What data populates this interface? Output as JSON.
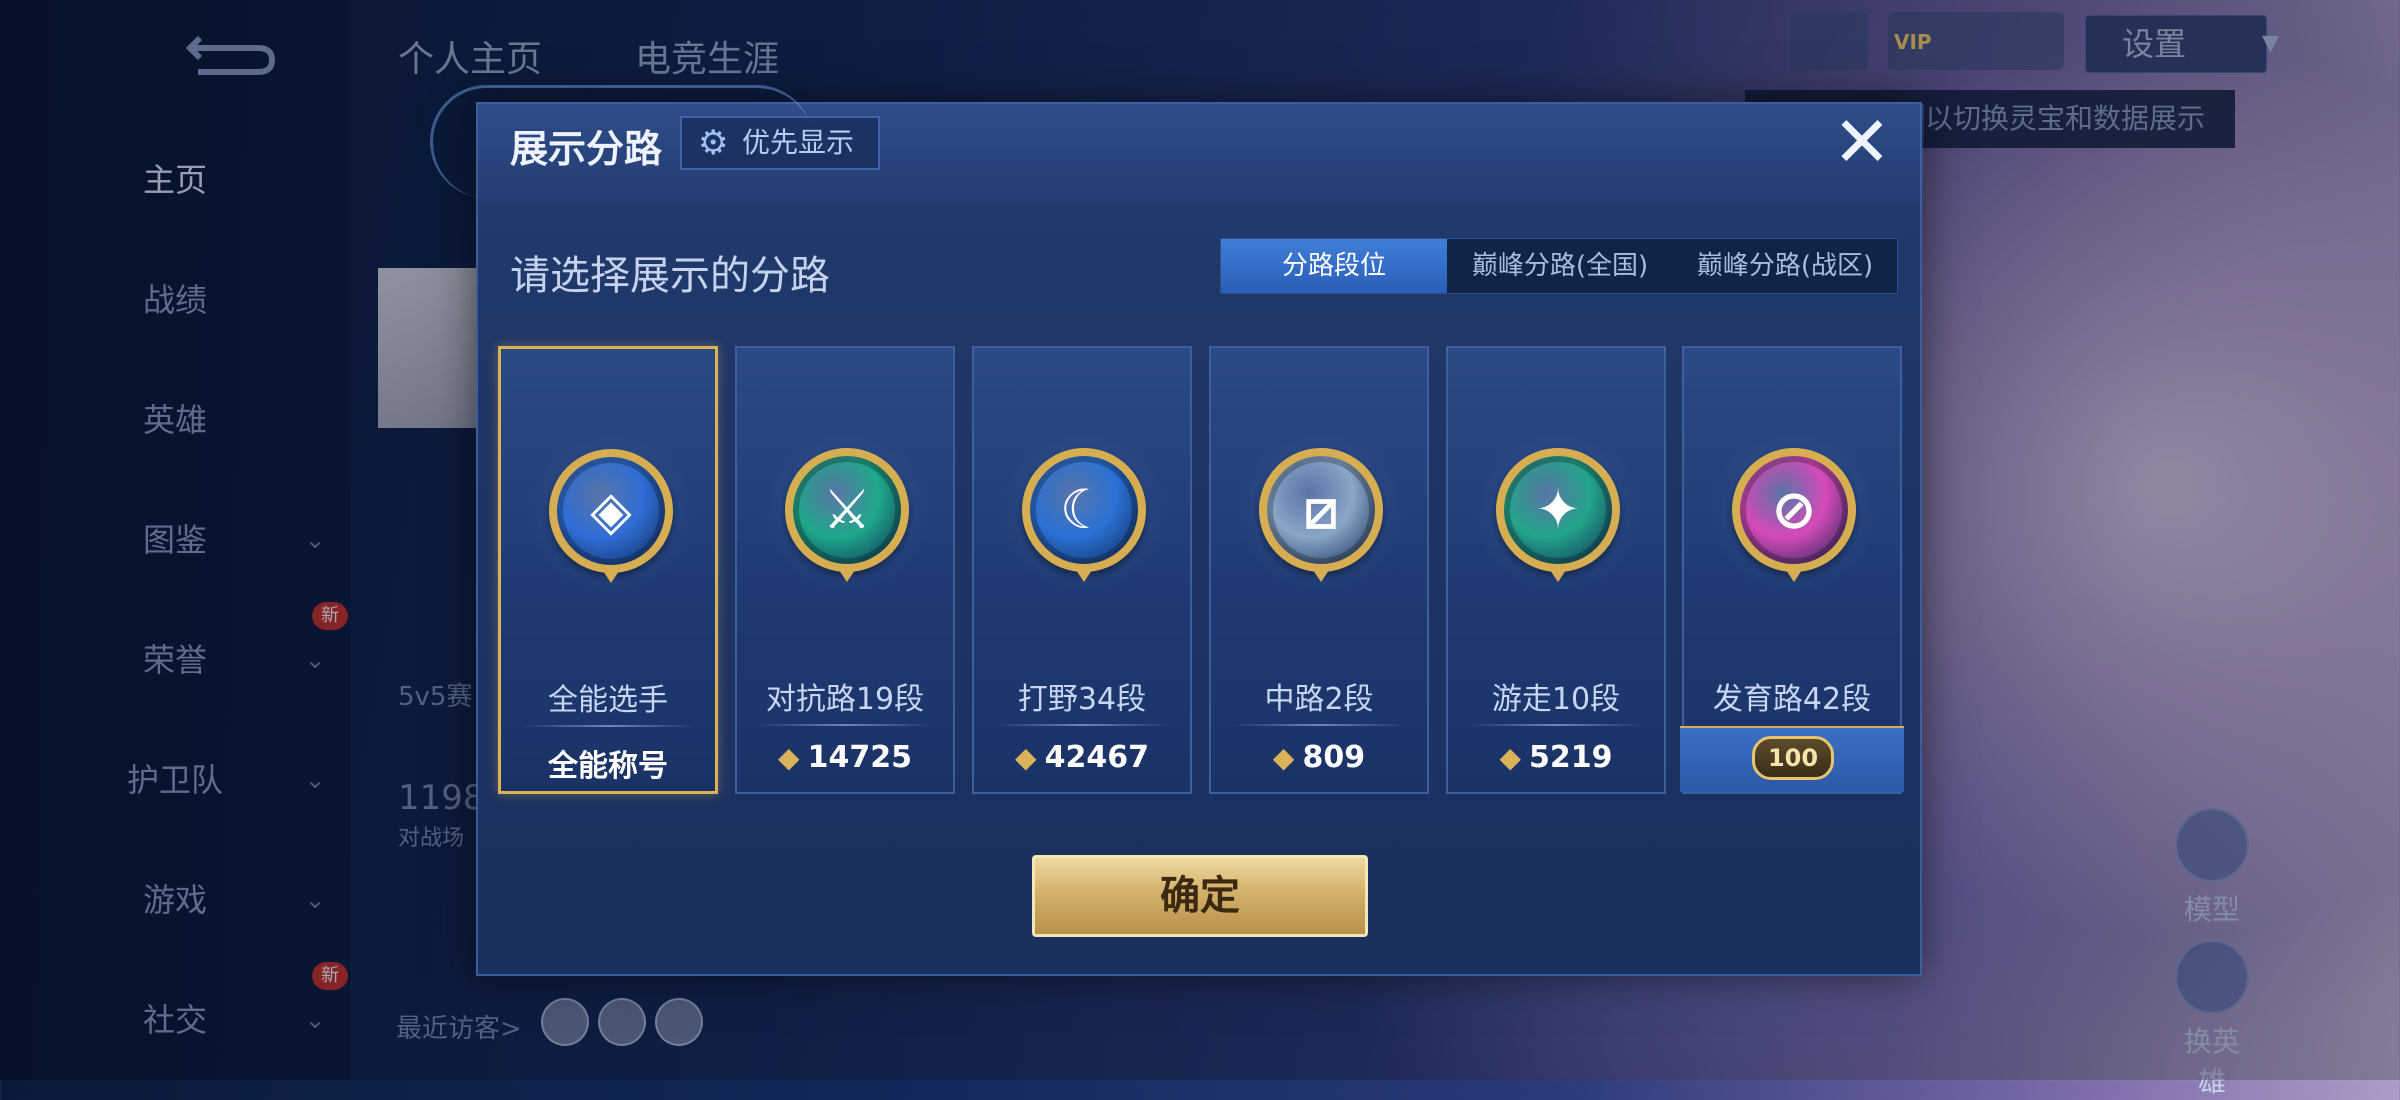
{
  "background": {
    "back_icon": "back-arrow-icon",
    "top_tabs": [
      "个人主页",
      "电竞生涯"
    ],
    "sidebar": [
      {
        "label": "主页",
        "active": true,
        "has_chevron": false,
        "new": false
      },
      {
        "label": "战绩",
        "active": false,
        "has_chevron": false,
        "new": false
      },
      {
        "label": "英雄",
        "active": false,
        "has_chevron": false,
        "new": false
      },
      {
        "label": "图鉴",
        "active": false,
        "has_chevron": true,
        "new": false
      },
      {
        "label": "荣誉",
        "active": false,
        "has_chevron": true,
        "new": true
      },
      {
        "label": "护卫队",
        "active": false,
        "has_chevron": true,
        "new": false
      },
      {
        "label": "游戏",
        "active": false,
        "has_chevron": true,
        "new": false
      },
      {
        "label": "社交",
        "active": false,
        "has_chevron": true,
        "new": true
      }
    ],
    "new_badge": "新",
    "texts": {
      "mode": "5v5赛",
      "number": "1198",
      "sub": "对战场",
      "recent_visitors": "最近访客>"
    },
    "settings_label": "设置",
    "tip_banner": "以切换灵宝和数据展示",
    "right_fabs": [
      "模型",
      "换英雄"
    ],
    "vip_badge": "VIP"
  },
  "modal": {
    "title": "展示分路",
    "priority_button": "优先显示",
    "close_icon": "close-icon",
    "subtitle": "请选择展示的分路",
    "tabs": [
      {
        "label": "分路段位",
        "active": true
      },
      {
        "label": "巅峰分路(全国)",
        "active": false
      },
      {
        "label": "巅峰分路(战区)",
        "active": false
      }
    ],
    "cards": [
      {
        "name": "全能选手",
        "value": "全能称号",
        "show_points_icon": false,
        "selected": true,
        "medal_color": "#2f6ed6",
        "glyph": "◈",
        "level_badge": null
      },
      {
        "name": "对抗路19段",
        "value": "14725",
        "show_points_icon": true,
        "selected": false,
        "medal_color": "#1fa98a",
        "glyph": "⚔",
        "level_badge": null
      },
      {
        "name": "打野34段",
        "value": "42467",
        "show_points_icon": true,
        "selected": false,
        "medal_color": "#2a72d6",
        "glyph": "☾",
        "level_badge": null
      },
      {
        "name": "中路2段",
        "value": "809",
        "show_points_icon": true,
        "selected": false,
        "medal_color": "#8aa6c8",
        "glyph": "⧄",
        "level_badge": null
      },
      {
        "name": "游走10段",
        "value": "5219",
        "show_points_icon": true,
        "selected": false,
        "medal_color": "#23a58a",
        "glyph": "✦",
        "level_badge": null
      },
      {
        "name": "发育路42段",
        "value": "",
        "show_points_icon": false,
        "selected": false,
        "medal_color": "#d64ab8",
        "glyph": "⊘",
        "level_badge": "100"
      }
    ],
    "confirm_label": "确定"
  }
}
